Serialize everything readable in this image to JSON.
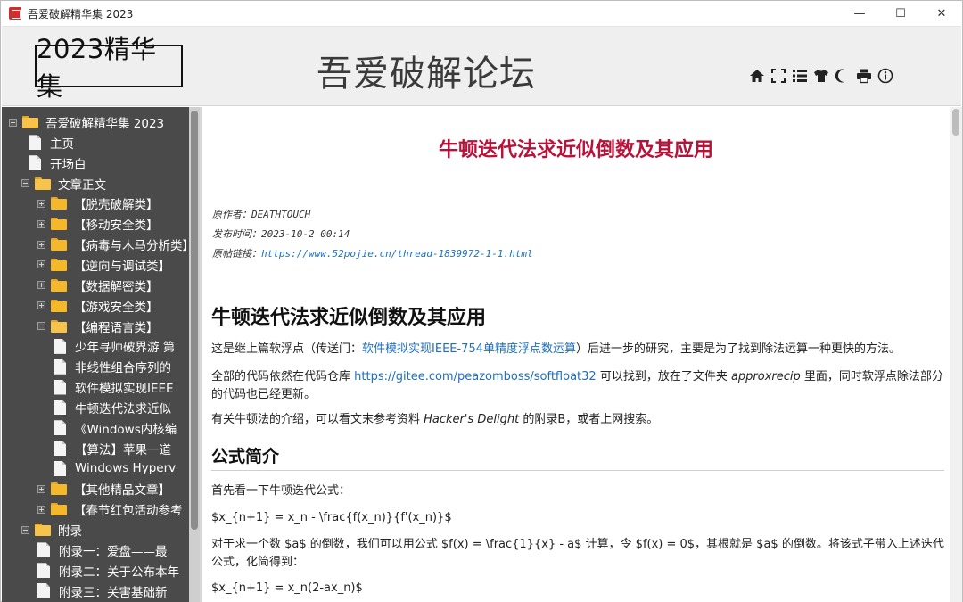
{
  "window": {
    "title": "吾爱破解精华集 2023",
    "minimize": "—",
    "maximize": "☐",
    "close": "✕"
  },
  "header": {
    "badge": "2023精华集",
    "title": "吾爱破解论坛",
    "tools": [
      "home-icon",
      "fullscreen-icon",
      "list-icon",
      "shirt-icon",
      "moon-icon",
      "print-icon",
      "info-icon"
    ]
  },
  "sidebar": {
    "items": [
      {
        "label": "吾爱破解精华集 2023",
        "type": "folder",
        "expander": "minus"
      },
      {
        "label": "主页",
        "type": "doc"
      },
      {
        "label": "开场白",
        "type": "doc"
      },
      {
        "label": "文章正文",
        "type": "folder",
        "expander": "minus"
      },
      {
        "label": "【脱壳破解类】",
        "type": "folder",
        "expander": "plus"
      },
      {
        "label": "【移动安全类】",
        "type": "folder",
        "expander": "plus"
      },
      {
        "label": "【病毒与木马分析类】",
        "type": "folder",
        "expander": "plus"
      },
      {
        "label": "【逆向与调试类】",
        "type": "folder",
        "expander": "plus"
      },
      {
        "label": "【数据解密类】",
        "type": "folder",
        "expander": "plus"
      },
      {
        "label": "【游戏安全类】",
        "type": "folder",
        "expander": "plus"
      },
      {
        "label": "【编程语言类】",
        "type": "folder",
        "expander": "minus"
      },
      {
        "label": "少年寻师破界游 第",
        "type": "doc"
      },
      {
        "label": "非线性组合序列的",
        "type": "doc"
      },
      {
        "label": "软件模拟实现IEEE",
        "type": "doc"
      },
      {
        "label": "牛顿迭代法求近似",
        "type": "doc"
      },
      {
        "label": "《Windows内核编",
        "type": "doc"
      },
      {
        "label": "【算法】苹果一道",
        "type": "doc"
      },
      {
        "label": "Windows Hyperv",
        "type": "doc"
      },
      {
        "label": "【其他精品文章】",
        "type": "folder",
        "expander": "plus"
      },
      {
        "label": "【春节红包活动参考",
        "type": "folder",
        "expander": "plus"
      },
      {
        "label": "附录",
        "type": "folder",
        "expander": "minus"
      },
      {
        "label": "附录一：爱盘——最",
        "type": "doc"
      },
      {
        "label": "附录二：关于公布本年",
        "type": "doc"
      },
      {
        "label": "附录三：关害基础新",
        "type": "doc"
      }
    ]
  },
  "article": {
    "title": "牛顿迭代法求近似倒数及其应用",
    "author_label": "原作者：",
    "author": "DEATHTOUCH",
    "time_label": "发布时间：",
    "time": "2023-10-2 00:14",
    "link_label": "原帖链接：",
    "link": "https://www.52pojie.cn/thread-1839972-1-1.html",
    "heading": "牛顿迭代法求近似倒数及其应用",
    "p1_a": "这是继上篇软浮点（传送门：",
    "p1_link": "软件模拟实现IEEE-754单精度浮点数运算",
    "p1_b": "）后进一步的研究，主要是为了找到除法运算一种更快的方法。",
    "p2_a": "全部的代码依然在代码仓库 ",
    "p2_link": "https://gitee.com/peazomboss/softfloat32",
    "p2_b": " 可以找到，放在了文件夹 ",
    "p2_em": "approxrecip",
    "p2_c": " 里面，同时软浮点除法部分的代码也已经更新。",
    "p3_a": "有关牛顿法的介绍，可以看文末参考资料 ",
    "p3_em": "Hacker's Delight",
    "p3_b": " 的附录B，或者上网搜索。",
    "section": "公式简介",
    "p4": "首先看一下牛顿迭代公式：",
    "p5": "$x_{n+1} = x_n - \\frac{f(x_n)}{f'(x_n)}$",
    "p6": "对于求一个数 $a$ 的倒数，我们可以用公式 $f(x) = \\frac{1}{x} - a$ 计算，令 $f(x) = 0$，其根就是 $a$ 的倒数。将该式子带入上述迭代公式，化简得到：",
    "p7": "$x_{n+1} = x_n(2-ax_n)$"
  },
  "colors": {
    "title_red": "#b8123a",
    "link_blue": "#1f6fbf",
    "sidebar_bg": "#4a4a4a",
    "folder": "#f5b82a"
  }
}
